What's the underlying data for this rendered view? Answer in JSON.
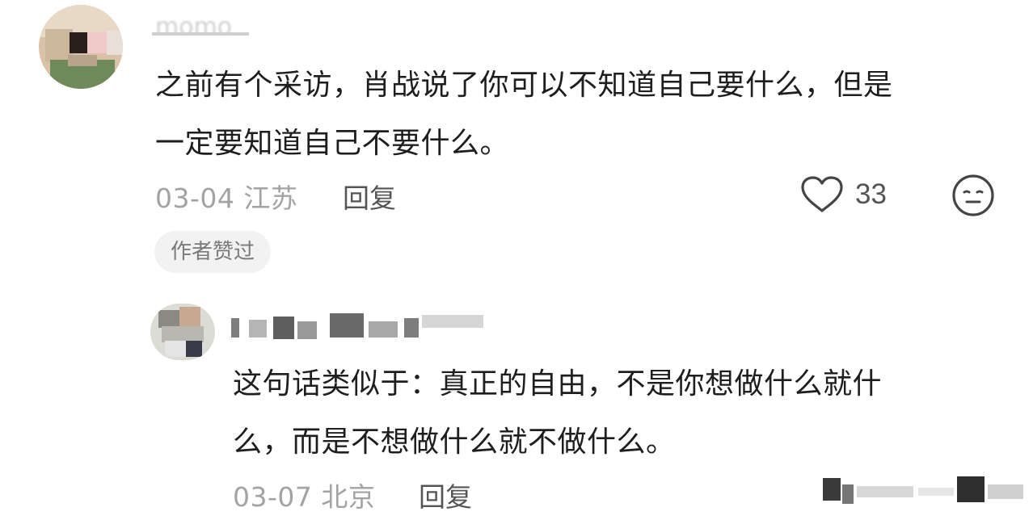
{
  "comment": {
    "username": "momo",
    "text_line1": "之前有个采访，肖战说了你可以不知道自己要什么，但是",
    "text_line2": "一定要知道自己不要什么。",
    "date_location": "03-04 江苏",
    "reply_label": "回复",
    "like_count": "33",
    "author_badge": "作者赞过"
  },
  "reply": {
    "text_line1": "这句话类似于：真正的自由，不是你想做什么就什",
    "text_line2": "么，而是不想做什么就不做什么。",
    "date_location": "03-07 北京",
    "reply_label": "回复"
  },
  "icons": {
    "like": "heart-outline-icon",
    "emoji": "neutral-face-icon"
  },
  "colors": {
    "text": "#1e1e1e",
    "meta": "#a3a3a3",
    "action": "#555555",
    "badge_bg": "#f2f2f2"
  }
}
